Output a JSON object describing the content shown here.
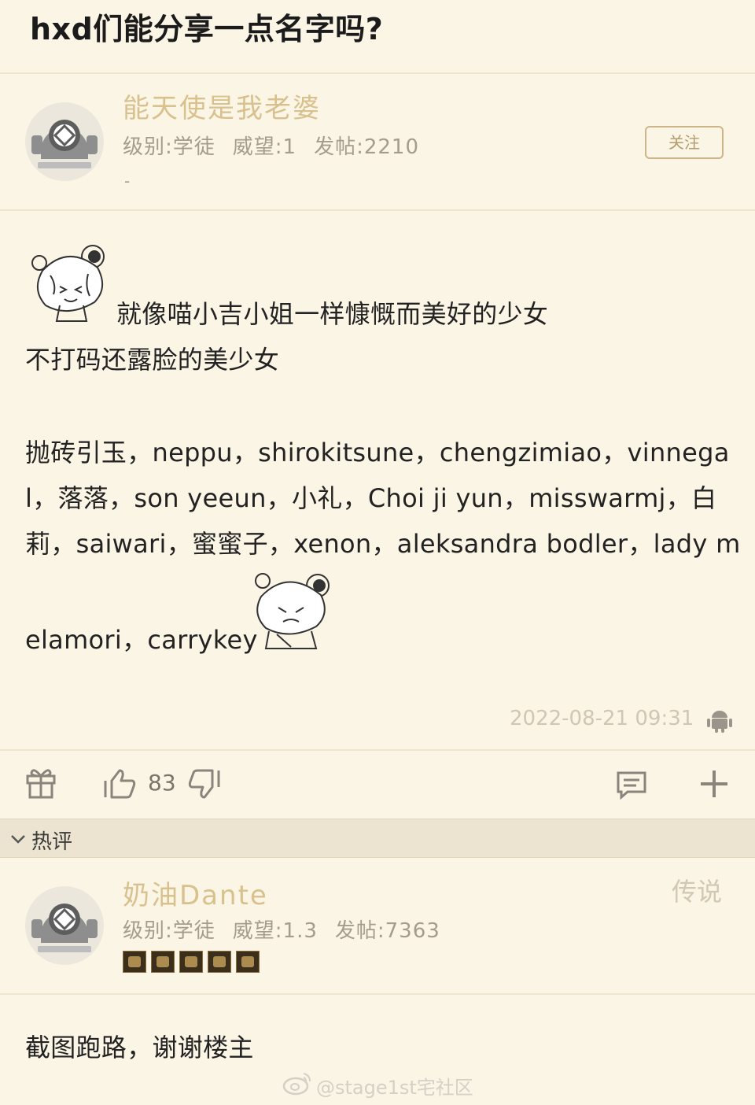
{
  "post": {
    "title": "hxd们能分享一点名字吗?"
  },
  "author": {
    "name": "能天使是我老婆",
    "level": "级别:学徒",
    "prestige": "威望:1",
    "posts": "发帖:2210",
    "signature": "-",
    "follow_label": "关注"
  },
  "body": {
    "line1": "就像喵小吉小姐一样慷慨而美好的少女",
    "line2": "不打码还露脸的美少女",
    "line3": "抛砖引玉，neppu，shirokitsune，chengzimiao，vinnega",
    "line4": "l，落落，son yeeun，小礼，Choi ji yun，misswarmj，白",
    "line5": "莉，saiwari，蜜蜜子，xenon，aleksandra bodler，lady m",
    "line6": "elamori，carrykey"
  },
  "meta": {
    "timestamp": "2022-08-21 09:31"
  },
  "actions": {
    "likes": "83"
  },
  "hot_section": {
    "label": "热评"
  },
  "reply": {
    "name": "奶油Dante",
    "tag": "传说",
    "level": "级别:学徒",
    "prestige": "威望:1.3",
    "posts": "发帖:7363",
    "text": "截图跑路，谢谢楼主"
  },
  "watermark": {
    "text": "@stage1st宅社区"
  },
  "icons": {
    "avatar": "diving-helmet-icon",
    "gift": "gift-icon",
    "like": "thumbs-up-icon",
    "dislike": "thumbs-down-icon",
    "comment": "comment-icon",
    "add": "plus-icon",
    "platform": "android-icon"
  }
}
